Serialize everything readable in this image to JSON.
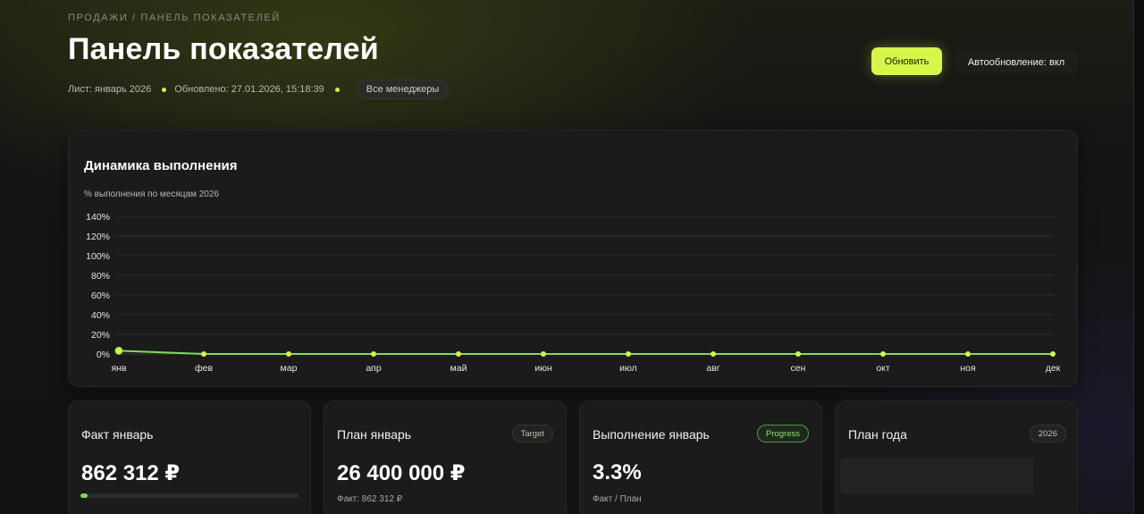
{
  "header": {
    "breadcrumb": "ПРОДАЖИ / ПАНЕЛЬ ПОКАЗАТЕЛЕЙ",
    "title": "Панель показателей",
    "sheet_label": "Лист: январь 2026",
    "updated_label": "Обновлено: 27.01.2026, 15:18:39",
    "managers_filter": "Все менеджеры",
    "refresh_button": "Обновить",
    "autorefresh_button": "Автообновление: вкл"
  },
  "colors": {
    "accent": "#d6f74a",
    "line": "#7fdc5a",
    "background": "#121212",
    "card": "#1b1b1b"
  },
  "chart_panel": {
    "title": "Динамика выполнения",
    "subtitle": "% выполнения по месяцам 2026"
  },
  "chart_data": {
    "type": "line",
    "categories": [
      "янв",
      "фев",
      "мар",
      "апр",
      "май",
      "июн",
      "июл",
      "авг",
      "сен",
      "окт",
      "ноя",
      "дек"
    ],
    "series": [
      {
        "values": [
          3.3,
          0,
          0,
          0,
          0,
          0,
          0,
          0,
          0,
          0,
          0,
          0
        ]
      }
    ],
    "ylim": [
      0,
      140
    ],
    "yticks": [
      "0%",
      "20%",
      "40%",
      "60%",
      "80%",
      "100%",
      "120%",
      "140%"
    ],
    "grid": true,
    "legend": "none"
  },
  "kpis": [
    {
      "title": "Факт январь",
      "value": "862 312 ₽",
      "progress": 0.033
    },
    {
      "title": "План январь",
      "value": "26 400 000 ₽",
      "badge": "Target",
      "sub": "Факт: 862 312 ₽"
    },
    {
      "title": "Выполнение январь",
      "value": "3.3%",
      "badge": "Progress",
      "sub": "Факт / План"
    },
    {
      "title": "План года",
      "badge": "2026"
    }
  ]
}
